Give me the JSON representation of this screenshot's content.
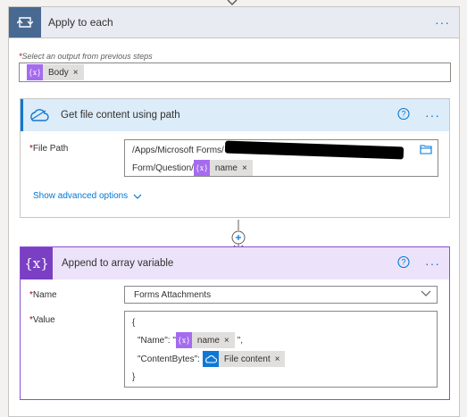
{
  "apply_each": {
    "title": "Apply to each",
    "more": "···",
    "select_label_req": "*",
    "select_label": "Select an output from previous steps",
    "token": {
      "label": "Body",
      "remove": "×"
    }
  },
  "get_file": {
    "title": "Get file content using path",
    "more": "···",
    "field_req": "*",
    "field_label": "File Path",
    "path_line1": "/Apps/Microsoft Forms/",
    "path_line2": "Form/Question/",
    "token": {
      "label": "name",
      "remove": "×"
    },
    "advanced": "Show advanced options"
  },
  "append": {
    "title": "Append to array variable",
    "more": "···",
    "icon_text": "{x}",
    "name_req": "*",
    "name_label": "Name",
    "name_value": "Forms Attachments",
    "value_req": "*",
    "value_label": "Value",
    "json_open": "{",
    "name_key": "\"Name\": \"",
    "name_token": {
      "label": "name",
      "remove": "×"
    },
    "name_suffix": "\",",
    "bytes_key": "\"ContentBytes\":",
    "bytes_token": {
      "label": "File content",
      "remove": "×"
    },
    "json_close": "}"
  },
  "colors": {
    "accent": "#0078d4",
    "apply_icon_bg": "#486991",
    "variable_purple": "#7a3fc3",
    "token_purple": "#a56bef",
    "onedrive_blue": "#0f78d4"
  }
}
